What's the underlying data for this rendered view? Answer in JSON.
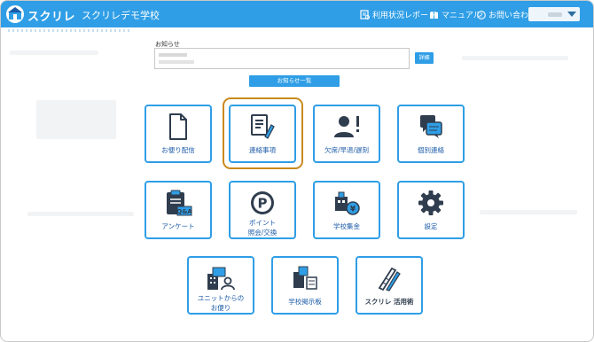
{
  "header": {
    "brand": "スクリレ",
    "school": "スクリレデモ学校",
    "nav": [
      {
        "label": "利用状況レポート",
        "icon": "usage-report-icon"
      },
      {
        "label": "マニュアル",
        "icon": "book-icon"
      },
      {
        "label": "お問い合わせ",
        "icon": "help-circle-icon"
      }
    ]
  },
  "notice": {
    "label": "お知らせ",
    "detail_label": "詳細",
    "list_label": "お知らせ一覧"
  },
  "tiles": [
    {
      "label": "お便り配信",
      "icon": "document-icon"
    },
    {
      "label": "連絡事項",
      "icon": "memo-pencil-icon"
    },
    {
      "label": "欠席/早退/遅刻",
      "icon": "person-alert-icon"
    },
    {
      "label": "個別連絡",
      "icon": "chat-bubbles-icon"
    },
    {
      "label": "アンケート",
      "icon": "clipboard-qa-icon"
    },
    {
      "label": "ポイント\n照会/交換",
      "icon": "point-coin-icon"
    },
    {
      "label": "学校集金",
      "icon": "school-yen-icon"
    },
    {
      "label": "設定",
      "icon": "gear-icon"
    },
    {
      "label": "ユニットからの\nお便り",
      "icon": "building-person-icon"
    },
    {
      "label": "学校掲示板",
      "icon": "board-icon"
    },
    {
      "label": "スクリレ 活用術",
      "icon": "ruler-pencil-icon"
    }
  ],
  "colors": {
    "accent": "#2f9ee6",
    "tile_text": "#1a5aa8",
    "highlight": "#c98a1e"
  }
}
